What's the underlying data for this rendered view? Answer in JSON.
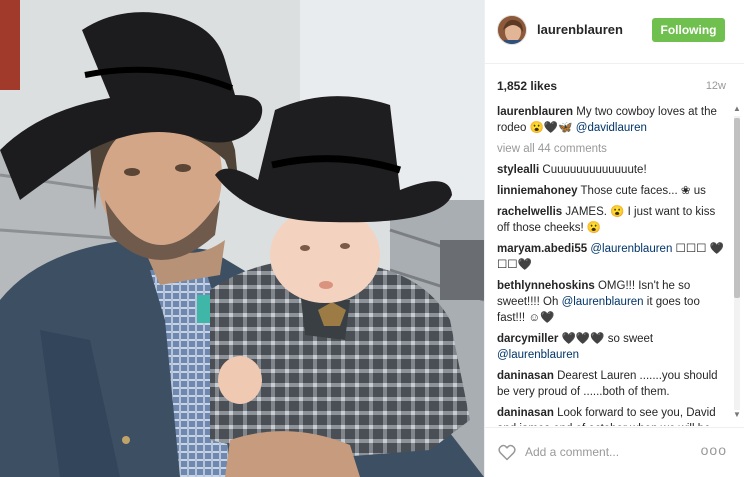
{
  "header": {
    "username": "laurenblauren",
    "follow_label": "Following"
  },
  "stats": {
    "likes": "1,852 likes",
    "time": "12w"
  },
  "caption": {
    "user": "laurenblauren",
    "text": " My two cowboy loves at the rodeo 😮🖤🦋 ",
    "mention": "@davidlauren"
  },
  "view_all": "view all 44 comments",
  "comments": [
    {
      "user": "stylealli",
      "text": " Cuuuuuuuuuuuuute!",
      "mention": "",
      "tail": ""
    },
    {
      "user": "linniemahoney",
      "text": " Those cute faces... ❀ us",
      "mention": "",
      "tail": ""
    },
    {
      "user": "rachelwellis",
      "text": " JAMES. 😮 I just want to kiss off those cheeks! 😮",
      "mention": "",
      "tail": ""
    },
    {
      "user": "maryam.abedi55",
      "text": " ",
      "mention": "@laurenblauren",
      "tail": " ☐☐☐ 🖤☐☐🖤"
    },
    {
      "user": "bethlynnehoskins",
      "text": " OMG!!! Isn't he so sweet!!!! Oh ",
      "mention": "@laurenblauren",
      "tail": " it goes too fast!!! ☺🖤"
    },
    {
      "user": "darcymiller",
      "text": " 🖤🖤🖤 so sweet ",
      "mention": "@laurenblauren",
      "tail": ""
    },
    {
      "user": "daninasan",
      "text": " Dearest Lauren .......you should be very proud of ......both of them.",
      "mention": "",
      "tail": ""
    },
    {
      "user": "daninasan",
      "text": " Look forward to see you, David and james end of october when we will be back in nyc Daniela Giuseppe",
      "mention": "",
      "tail": ""
    }
  ],
  "footer": {
    "placeholder": "Add a comment...",
    "more": "ooo"
  }
}
